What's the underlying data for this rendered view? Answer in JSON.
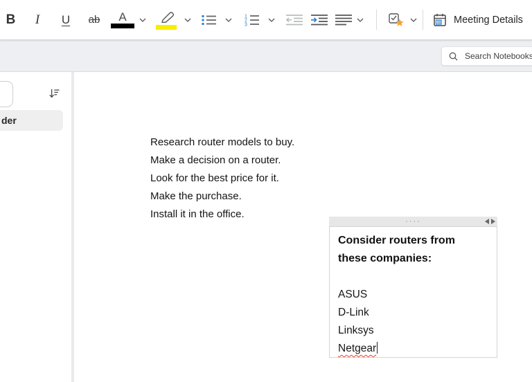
{
  "toolbar": {
    "bold_label": "B",
    "italic_label": "I",
    "underline_label": "U",
    "strikethrough_label": "ab",
    "font_color_label": "A",
    "meeting_details_label": "Meeting Details"
  },
  "search": {
    "placeholder": "Search Notebooks"
  },
  "sidebar": {
    "selected_folder_label": "der"
  },
  "page": {
    "lines": [
      "Research router models to buy.",
      "Make a decision on a router.",
      "Look for the best price for it.",
      "Make the purchase.",
      "Install it in the office."
    ]
  },
  "note": {
    "drag_handle_dots": "····",
    "heading_lines": [
      "Consider routers from",
      "these companies:"
    ],
    "companies": [
      "ASUS",
      "D-Link",
      "Linksys"
    ],
    "misspelled_company": "Netgear"
  },
  "icons": {
    "font_color": "A over black bar",
    "highlighter": "marker over yellow bar",
    "bullet_list": "blue squares with lines",
    "numbered_list": "blue 1-2-3 with lines",
    "decrease_indent": "gray left arrow with lines",
    "increase_indent": "blue right arrow with lines",
    "align": "horizontal lines",
    "tag": "checkbox with orange star",
    "meeting": "calendar with blue list",
    "search": "magnifier",
    "sort": "down arrow with decreasing lines",
    "drag_handle": "four dots",
    "resize": "left and right triangles"
  },
  "colors": {
    "accent_blue": "#2b7cd3",
    "highlight_yellow": "#f8ee00",
    "star_orange": "#f2a33c",
    "misspell_red": "#e0422e",
    "band_gray": "#edeff2",
    "selected_row_gray": "#efefef",
    "note_header_gray": "#e7e7e7"
  }
}
